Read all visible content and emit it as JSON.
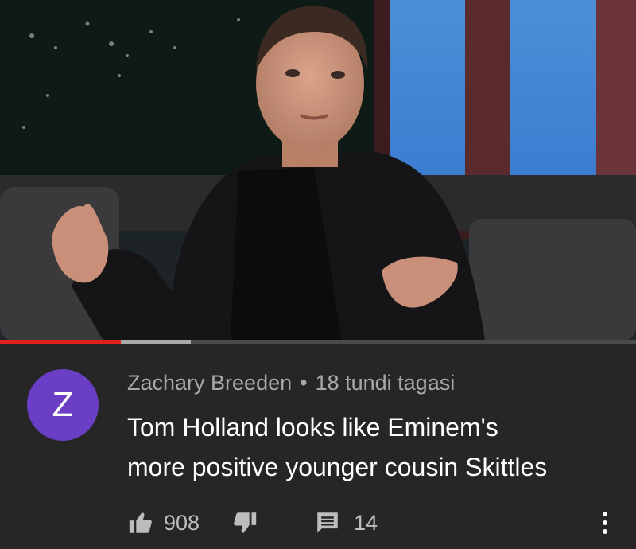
{
  "video": {
    "progress_played_fraction": 0.19,
    "progress_buffered_fraction": 0.3
  },
  "comment": {
    "avatar_initial": "Z",
    "author": "Zachary Breeden",
    "separator": "•",
    "time_ago": "18 tundi tagasi",
    "text_lines": [
      "Tom Holland looks like Eminem's",
      "more positive younger cousin Skittles"
    ],
    "likes": "908",
    "replies": "14"
  },
  "icons": {
    "like": "thumb-up-icon",
    "dislike": "thumb-down-icon",
    "replies": "comment-icon",
    "more": "more-vertical-icon"
  },
  "colors": {
    "background": "#262626",
    "avatar": "#6a3fc6",
    "progress_played": "#e0201b",
    "meta_text": "#a8a8a8",
    "comment_text": "#ffffff"
  }
}
